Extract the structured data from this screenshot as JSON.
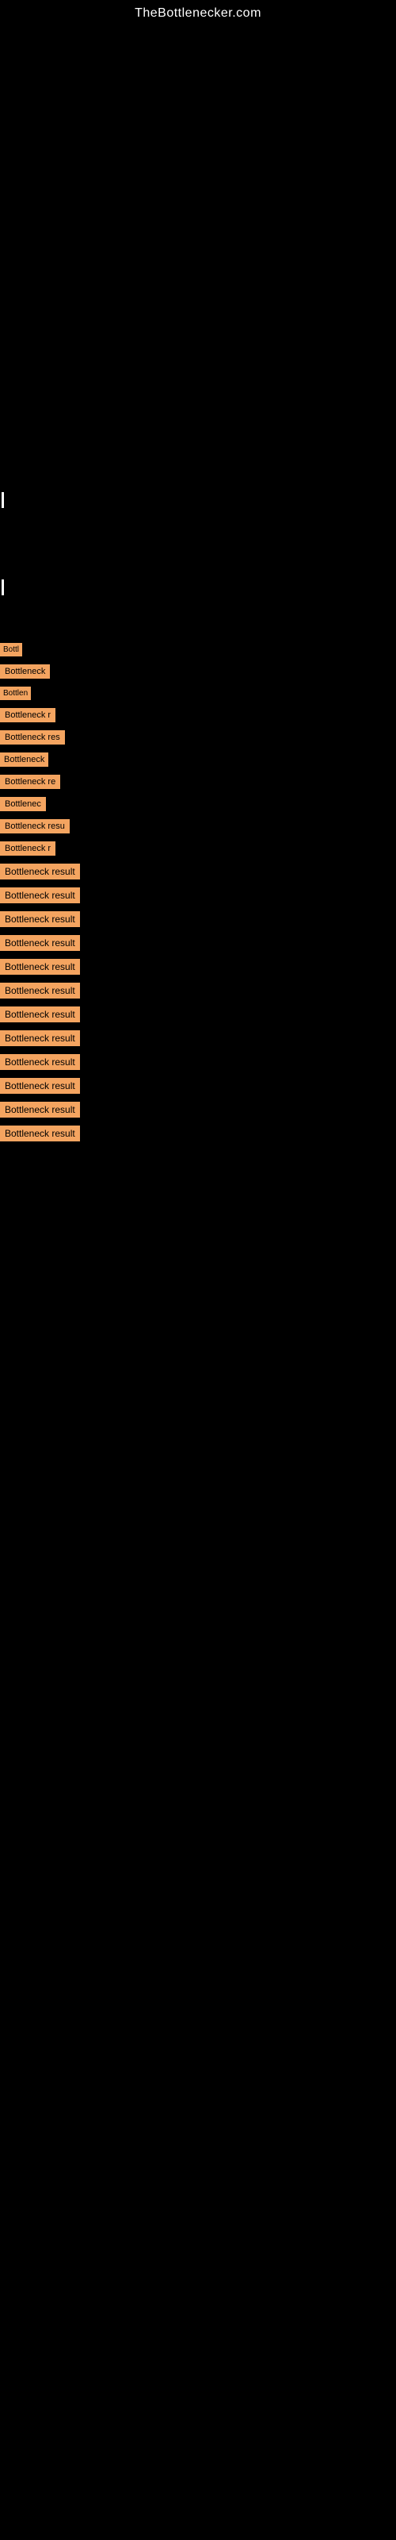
{
  "site": {
    "title": "TheBottlenecker.com"
  },
  "bottleneck_items": [
    {
      "id": 1,
      "label": "Bottl"
    },
    {
      "id": 2,
      "label": "Bottleneck"
    },
    {
      "id": 3,
      "label": "Bottlen"
    },
    {
      "id": 4,
      "label": "Bottleneck r"
    },
    {
      "id": 5,
      "label": "Bottleneck res"
    },
    {
      "id": 6,
      "label": "Bottleneck"
    },
    {
      "id": 7,
      "label": "Bottleneck re"
    },
    {
      "id": 8,
      "label": "Bottlenec"
    },
    {
      "id": 9,
      "label": "Bottleneck resu"
    },
    {
      "id": 10,
      "label": "Bottleneck r"
    },
    {
      "id": 11,
      "label": "Bottleneck result"
    },
    {
      "id": 12,
      "label": "Bottleneck result"
    },
    {
      "id": 13,
      "label": "Bottleneck result"
    },
    {
      "id": 14,
      "label": "Bottleneck result"
    },
    {
      "id": 15,
      "label": "Bottleneck result"
    },
    {
      "id": 16,
      "label": "Bottleneck result"
    },
    {
      "id": 17,
      "label": "Bottleneck result"
    },
    {
      "id": 18,
      "label": "Bottleneck result"
    },
    {
      "id": 19,
      "label": "Bottleneck result"
    },
    {
      "id": 20,
      "label": "Bottleneck result"
    },
    {
      "id": 21,
      "label": "Bottleneck result"
    },
    {
      "id": 22,
      "label": "Bottleneck result"
    }
  ]
}
